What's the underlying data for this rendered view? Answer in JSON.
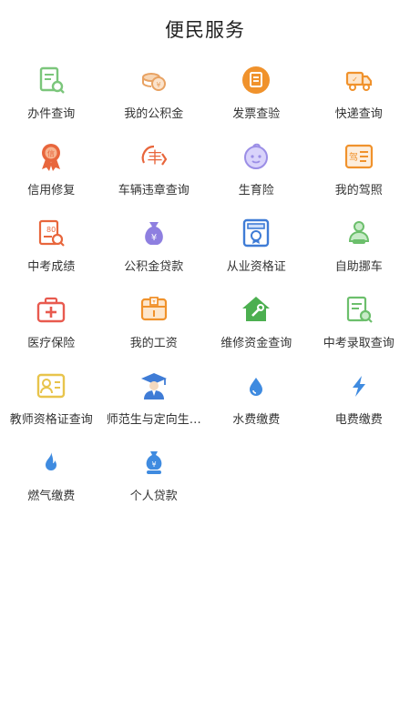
{
  "header": {
    "title": "便民服务"
  },
  "services": [
    {
      "label": "办件查询",
      "icon": "document-search-icon",
      "color": "#7bc67b"
    },
    {
      "label": "我的公积金",
      "icon": "coins-icon",
      "color": "#e8a262"
    },
    {
      "label": "发票查验",
      "icon": "invoice-icon",
      "color": "#f0922c"
    },
    {
      "label": "快递查询",
      "icon": "delivery-truck-icon",
      "color": "#f0922c"
    },
    {
      "label": "信用修复",
      "icon": "credit-medal-icon",
      "color": "#e8663c"
    },
    {
      "label": "车辆违章查询",
      "icon": "traffic-violation-icon",
      "color": "#e8663c"
    },
    {
      "label": "生育险",
      "icon": "baby-face-icon",
      "color": "#9b8ee6"
    },
    {
      "label": "我的驾照",
      "icon": "driver-license-icon",
      "color": "#f0922c"
    },
    {
      "label": "中考成绩",
      "icon": "score-report-icon",
      "color": "#e8663c"
    },
    {
      "label": "公积金贷款",
      "icon": "money-bag-icon",
      "color": "#8e7fe0"
    },
    {
      "label": "从业资格证",
      "icon": "certificate-badge-icon",
      "color": "#3f7cd6"
    },
    {
      "label": "自助挪车",
      "icon": "person-car-icon",
      "color": "#6cbf6c"
    },
    {
      "label": "医疗保险",
      "icon": "first-aid-kit-icon",
      "color": "#e85a4f"
    },
    {
      "label": "我的工资",
      "icon": "salary-box-icon",
      "color": "#f0922c"
    },
    {
      "label": "维修资金查询",
      "icon": "house-repair-icon",
      "color": "#4caf50"
    },
    {
      "label": "中考录取查询",
      "icon": "admission-search-icon",
      "color": "#6cbf6c"
    },
    {
      "label": "教师资格证查询",
      "icon": "teacher-card-icon",
      "color": "#e8c44c"
    },
    {
      "label": "师范生与定向生…",
      "icon": "graduate-icon",
      "color": "#3f7cd6"
    },
    {
      "label": "水费缴费",
      "icon": "water-drop-icon",
      "color": "#3f8be0"
    },
    {
      "label": "电费缴费",
      "icon": "lightning-icon",
      "color": "#3f8be0"
    },
    {
      "label": "燃气缴费",
      "icon": "flame-icon",
      "color": "#3f8be0"
    },
    {
      "label": "个人贷款",
      "icon": "loan-bag-icon",
      "color": "#3f8be0"
    }
  ]
}
